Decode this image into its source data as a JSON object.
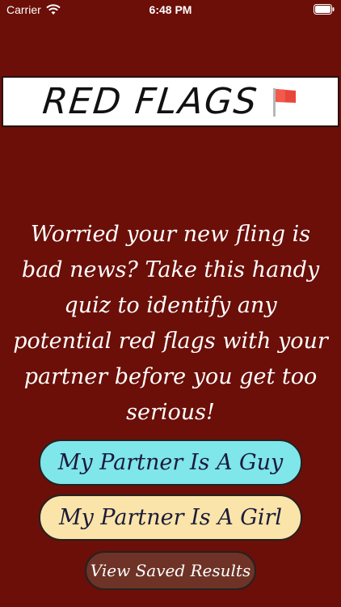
{
  "status_bar": {
    "carrier": "Carrier",
    "time": "6:48 PM"
  },
  "banner": {
    "title": "RED FLAGS",
    "icon": "red-flag-icon"
  },
  "intro_text": "Worried your new fling is bad news? Take this handy quiz to identify any potential red flags with your partner before you get too serious!",
  "buttons": {
    "guy": "My Partner Is A Guy",
    "girl": "My Partner Is A Girl",
    "saved": "View Saved Results"
  },
  "colors": {
    "background": "#6b0f08",
    "guy_button": "#7fe6ea",
    "girl_button": "#fbe4a9",
    "saved_button": "#6e3326",
    "flag": "#e8463a"
  }
}
